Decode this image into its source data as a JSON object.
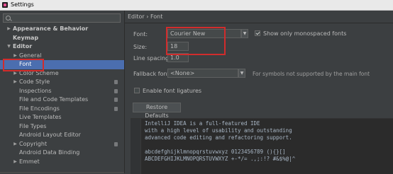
{
  "window": {
    "title": "Settings"
  },
  "breadcrumb": "Editor › Font",
  "tree": [
    {
      "label": "Appearance & Behavior",
      "level": 0,
      "arrow": "▶",
      "bold": true
    },
    {
      "label": "Keymap",
      "level": 0,
      "arrow": "",
      "bold": true
    },
    {
      "label": "Editor",
      "level": 0,
      "arrow": "▼",
      "bold": true
    },
    {
      "label": "General",
      "level": 1,
      "arrow": "▶"
    },
    {
      "label": "Font",
      "level": 1,
      "arrow": "",
      "selected": true
    },
    {
      "label": "Color Scheme",
      "level": 1,
      "arrow": "▶"
    },
    {
      "label": "Code Style",
      "level": 1,
      "arrow": "▶",
      "projectIcon": true
    },
    {
      "label": "Inspections",
      "level": 1,
      "arrow": "",
      "projectIcon": true
    },
    {
      "label": "File and Code Templates",
      "level": 1,
      "arrow": "",
      "projectIcon": true
    },
    {
      "label": "File Encodings",
      "level": 1,
      "arrow": "",
      "projectIcon": true
    },
    {
      "label": "Live Templates",
      "level": 1,
      "arrow": ""
    },
    {
      "label": "File Types",
      "level": 1,
      "arrow": ""
    },
    {
      "label": "Android Layout Editor",
      "level": 1,
      "arrow": ""
    },
    {
      "label": "Copyright",
      "level": 1,
      "arrow": "▶",
      "projectIcon": true
    },
    {
      "label": "Android Data Binding",
      "level": 1,
      "arrow": ""
    },
    {
      "label": "Emmet",
      "level": 1,
      "arrow": "▶"
    }
  ],
  "font": {
    "font_label": "Font:",
    "font_value": "Courier New",
    "show_mono_label": "Show only monospaced fonts",
    "show_mono_checked": true,
    "size_label": "Size:",
    "size_value": "18",
    "line_spacing_label": "Line spacing:",
    "line_spacing_value": "1.0",
    "fallback_label": "Fallback font:",
    "fallback_value": "<None>",
    "fallback_note": "For symbols not supported by the main font",
    "ligatures_label": "Enable font ligatures",
    "ligatures_checked": false,
    "restore_label": "Restore Defaults"
  },
  "preview": {
    "lines": [
      "IntelliJ IDEA is a full-featured IDE",
      "with a high level of usability and outstanding",
      "advanced code editing and refactoring support.",
      "",
      "abcdefghijklmnopqrstuvwxyz 0123456789 (){}[]",
      "ABCDEFGHIJKLMNOPQRSTUVWXYZ +-*/= .,;:!? #&$%@|^"
    ]
  },
  "colors": {
    "selection": "#4b6eaf",
    "highlight": "#d12c2c",
    "background": "#3c3f41"
  }
}
